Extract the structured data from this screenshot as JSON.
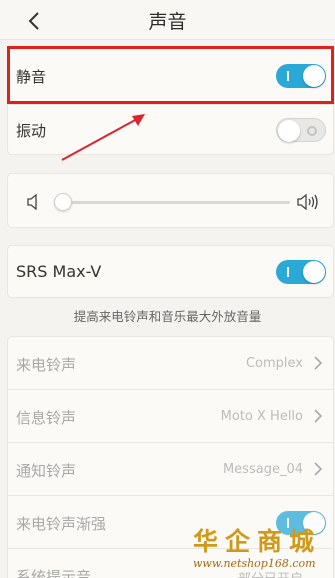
{
  "header": {
    "title": "声音"
  },
  "mute": {
    "label": "静音",
    "enabled": true
  },
  "vibrate": {
    "label": "振动",
    "enabled": false
  },
  "volume": {
    "level": 0.0,
    "min_icon": "speaker-low-icon",
    "max_icon": "speaker-high-icon"
  },
  "srs": {
    "label": "SRS Max-V",
    "enabled": true,
    "caption": "提高来电铃声和音乐最大外放音量"
  },
  "ringtones": [
    {
      "label": "来电铃声",
      "value": "Complex"
    },
    {
      "label": "信息铃声",
      "value": "Moto X Hello"
    },
    {
      "label": "通知铃声",
      "value": "Message_04"
    }
  ],
  "ring_fade": {
    "label": "来电铃声渐强",
    "enabled": true
  },
  "system_sound": {
    "label": "系统提示音",
    "value": "部分已开启"
  },
  "watermark": {
    "name": "华企商城",
    "url": "www.netshop168.com"
  },
  "colors": {
    "accent": "#2aa8d6",
    "highlight": "#e0201a",
    "arrow": "#d8262c",
    "watermark": "#cf9a1a"
  }
}
